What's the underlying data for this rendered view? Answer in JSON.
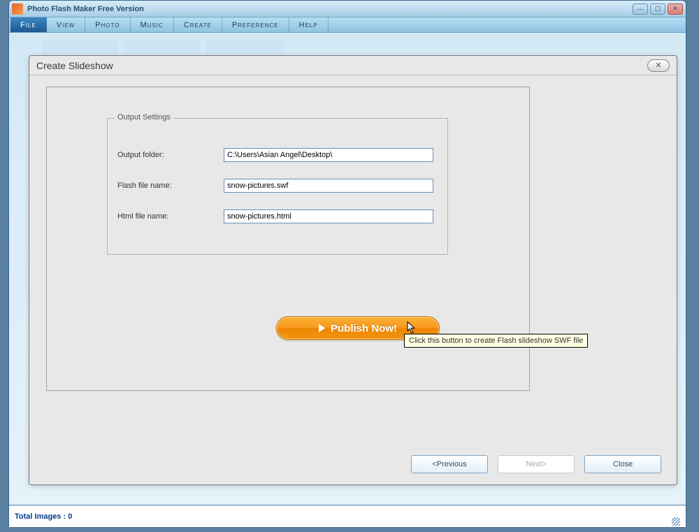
{
  "window": {
    "title": "Photo Flash Maker Free Version"
  },
  "menu": {
    "items": [
      "File",
      "View",
      "Photo",
      "Music",
      "Create",
      "Preference",
      "Help"
    ],
    "activeIndex": 0
  },
  "statusbar": {
    "text": "Total Images : 0"
  },
  "dialog": {
    "title": "Create Slideshow",
    "fieldset_legend": "Output Settings",
    "rows": {
      "output_folder": {
        "label": "Output folder:",
        "value": "C:\\Users\\Asian Angel\\Desktop\\"
      },
      "flash_file": {
        "label": "Flash file name:",
        "value": "snow-pictures.swf"
      },
      "html_file": {
        "label": "Html file name:",
        "value": "snow-pictures.html"
      }
    },
    "publish_label": "Publish Now!",
    "tooltip": "Click this button to create Flash slideshow SWF file",
    "nav": {
      "previous": "<Previous",
      "next": "Next>",
      "close": "Close"
    }
  }
}
